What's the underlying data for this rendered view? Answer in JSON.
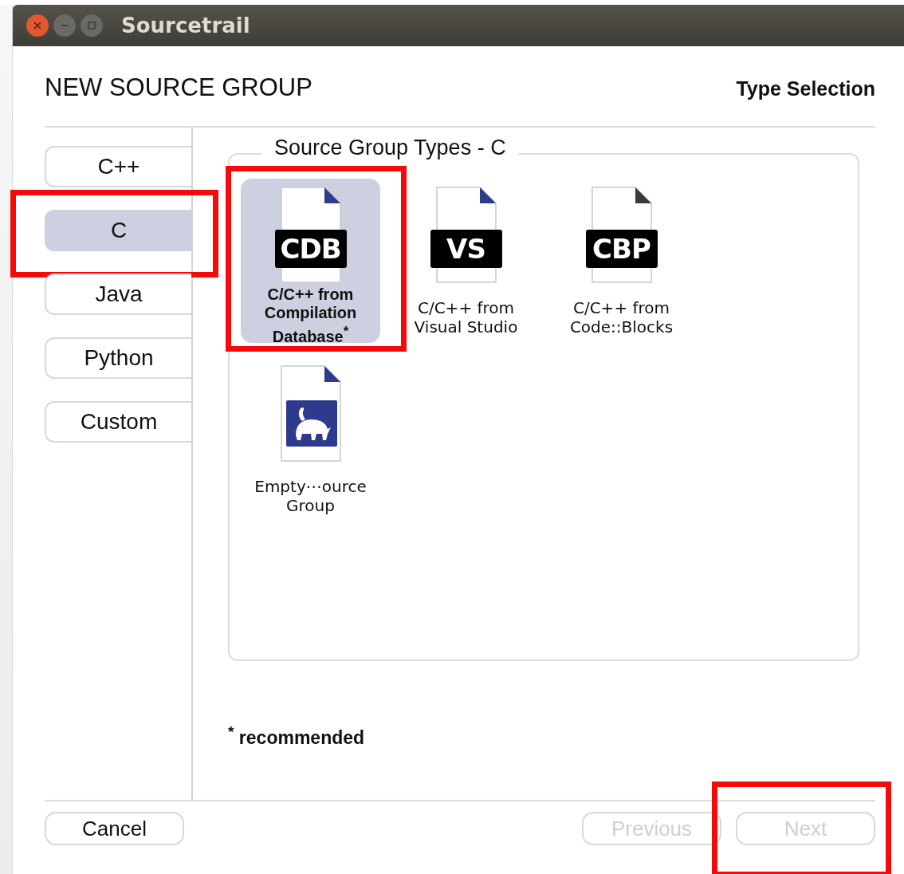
{
  "window": {
    "title": "Sourcetrail"
  },
  "header": {
    "title": "NEW SOURCE GROUP",
    "step": "Type Selection"
  },
  "sidebar": {
    "items": [
      {
        "label": "C++",
        "selected": false,
        "highlighted": false
      },
      {
        "label": "C",
        "selected": true,
        "highlighted": true
      },
      {
        "label": "Java",
        "selected": false,
        "highlighted": false
      },
      {
        "label": "Python",
        "selected": false,
        "highlighted": false
      },
      {
        "label": "Custom",
        "selected": false,
        "highlighted": false
      }
    ]
  },
  "group_box": {
    "title": "Source Group Types - C",
    "items": [
      {
        "kind": "badge",
        "badge": "CDB",
        "label": "C/C++ from Compilation Database$^{*}$",
        "color": "#2e3a8c",
        "selected": true,
        "highlighted": true
      },
      {
        "kind": "badge",
        "badge": "VS",
        "label": "C/C++ from Visual Studio",
        "color": "#2e3a8c",
        "selected": false,
        "highlighted": false
      },
      {
        "kind": "badge",
        "badge": "CBP",
        "label": "C/C++ from Code::Blocks",
        "color": "#3a3a3a",
        "selected": false,
        "highlighted": false
      },
      {
        "kind": "logo",
        "label": "Empty⋯ource Group",
        "color": "#2e3a8c",
        "selected": false,
        "highlighted": false
      }
    ]
  },
  "note": "$^{*}$ recommended",
  "buttons": [
    {
      "label": "Cancel",
      "disabled": false,
      "highlighted": false
    },
    {
      "label": "Previous",
      "disabled": true,
      "highlighted": false
    },
    {
      "label": "Next",
      "disabled": true,
      "highlighted": true
    }
  ]
}
